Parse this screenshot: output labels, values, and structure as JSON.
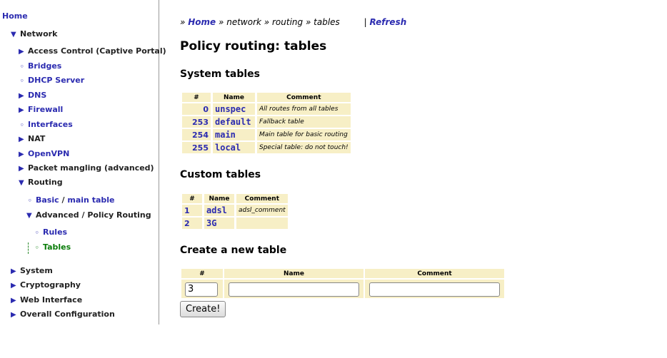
{
  "sidebar": {
    "home": "Home",
    "network": "Network",
    "access_control": "Access Control (Captive Portal)",
    "bridges": "Bridges",
    "dhcp": "DHCP Server",
    "dns": "DNS",
    "firewall": "Firewall",
    "interfaces": "Interfaces",
    "nat": "NAT",
    "openvpn": "OpenVPN",
    "packet_mangling": "Packet mangling (advanced)",
    "routing": "Routing",
    "basic": "Basic",
    "basic_sep": "/",
    "main_table": "main table",
    "advanced": "Advanced / Policy Routing",
    "rules": "Rules",
    "tables": "Tables",
    "system": "System",
    "cryptography": "Cryptography",
    "web_interface": "Web Interface",
    "overall": "Overall Configuration"
  },
  "breadcrumb": {
    "prefix": "»",
    "home": "Home",
    "sep1": "» network » routing » tables",
    "bar": "|",
    "refresh": "Refresh"
  },
  "page_title": "Policy routing: tables",
  "system_tables": {
    "heading": "System tables",
    "headers": [
      "#",
      "Name",
      "Comment"
    ],
    "rows": [
      {
        "num": "0",
        "name": "unspec",
        "comment": "All routes from all tables"
      },
      {
        "num": "253",
        "name": "default",
        "comment": "Fallback table"
      },
      {
        "num": "254",
        "name": "main",
        "comment": "Main table for basic routing"
      },
      {
        "num": "255",
        "name": "local",
        "comment": "Special table: do not touch!"
      }
    ]
  },
  "custom_tables": {
    "heading": "Custom tables",
    "headers": [
      "#",
      "Name",
      "Comment"
    ],
    "rows": [
      {
        "num": "1",
        "name": "adsl",
        "comment": "adsl_comment"
      },
      {
        "num": "2",
        "name": "3G",
        "comment": ""
      }
    ]
  },
  "create": {
    "heading": "Create a new table",
    "headers": [
      "#",
      "Name",
      "Comment"
    ],
    "num_value": "3",
    "name_value": "",
    "comment_value": "",
    "button": "Create!"
  }
}
